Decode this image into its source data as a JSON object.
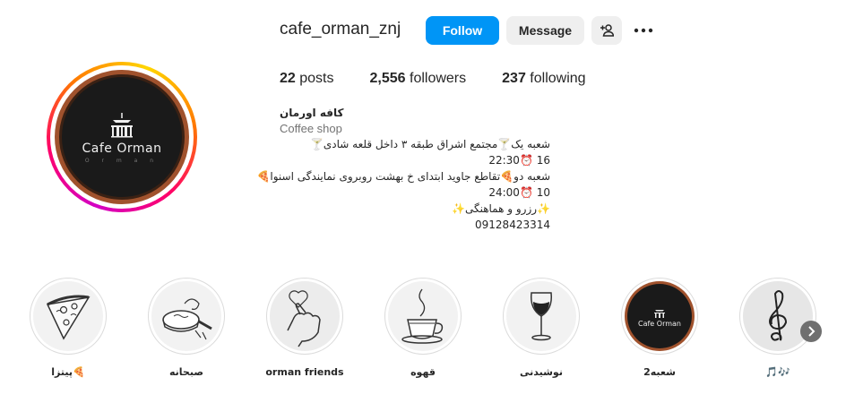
{
  "profile": {
    "username": "cafe_orman_znj",
    "logo_text": "Cafe Orman",
    "logo_sub": "O r m a n"
  },
  "actions": {
    "follow": "Follow",
    "message": "Message"
  },
  "stats": {
    "posts_count": "22",
    "posts_label": "posts",
    "followers_count": "2,556",
    "followers_label": "followers",
    "following_count": "237",
    "following_label": "following"
  },
  "bio": {
    "full_name": "کافه اورمان",
    "category": "Coffee shop",
    "lines": [
      "شعبه یک🍸مجتمع اشراق طبقه ۳ داخل قلعه شادی🍸",
      "16 ⏰22:30",
      "شعبه دو🍕تقاطع جاوید ابتدای خ بهشت روبروی نمایندگی اسنوا🍕",
      "10 ⏰24:00",
      "✨رزرو و هماهنگی✨",
      "09128423314"
    ]
  },
  "highlights": [
    {
      "label": "پیتزا🍕",
      "icon": "pizza-icon"
    },
    {
      "label": "صبحانه",
      "icon": "breakfast-pan-icon"
    },
    {
      "label": "orman friends",
      "icon": "finger-heart-icon"
    },
    {
      "label": "قهوه",
      "icon": "coffee-cup-icon"
    },
    {
      "label": "نوشیدنی",
      "icon": "wine-glass-icon"
    },
    {
      "label": "شعبه2",
      "icon": "cafe-logo-icon"
    },
    {
      "label": "🎵🎶",
      "icon": "treble-clef-icon"
    }
  ],
  "colors": {
    "follow_button": "#0095f6",
    "secondary_button": "#efefef",
    "text": "#262626",
    "muted_text": "#737373"
  }
}
